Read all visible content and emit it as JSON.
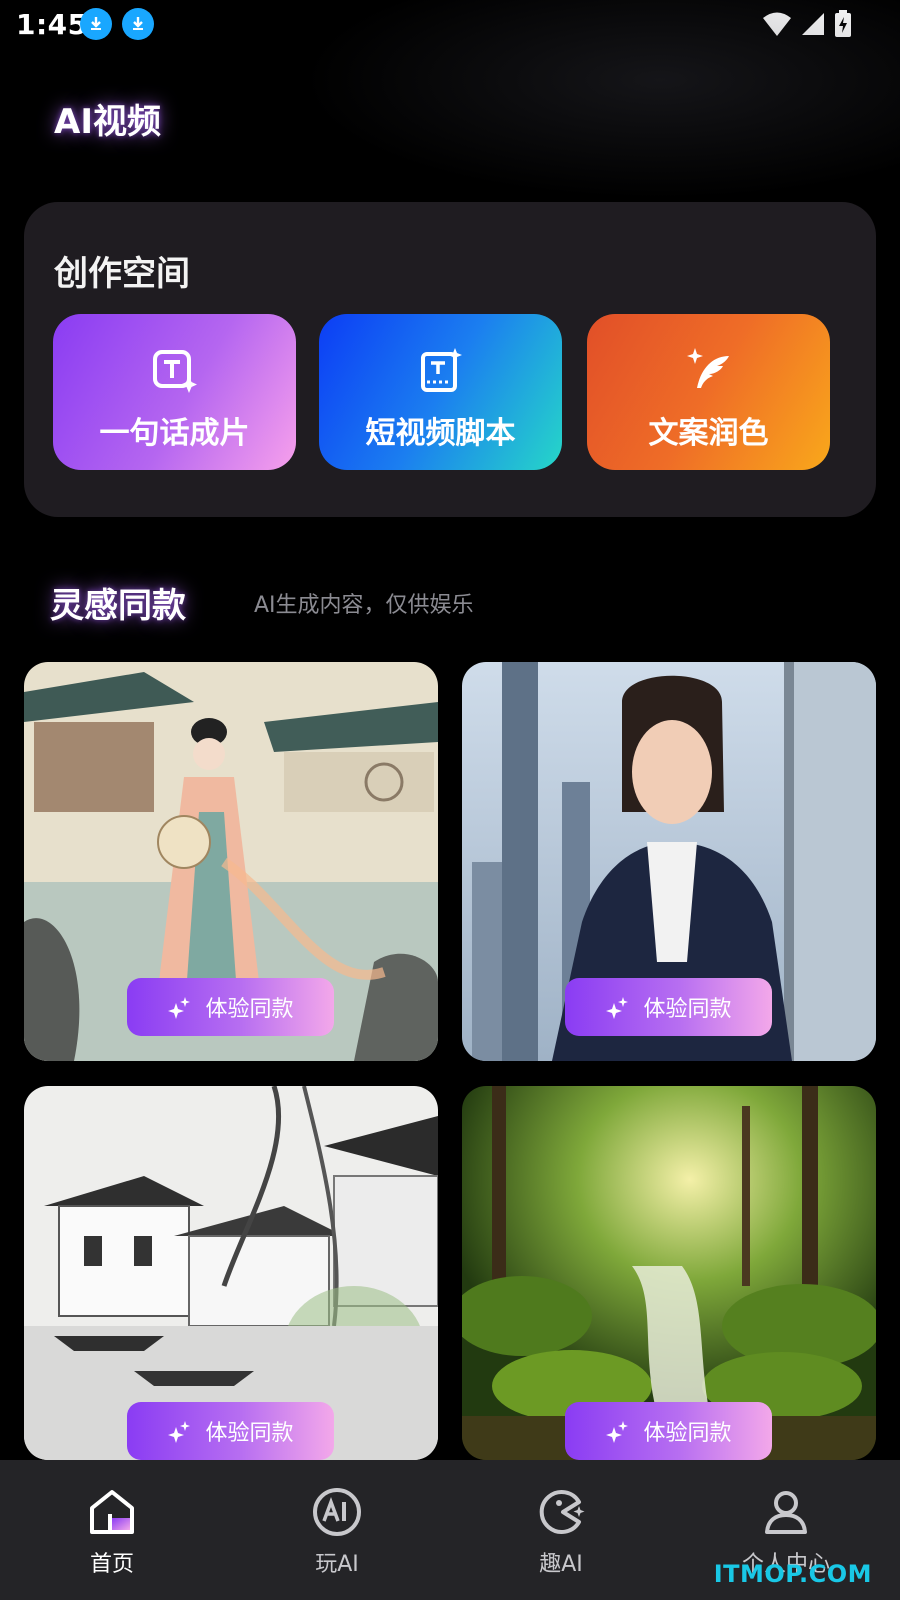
{
  "status_bar": {
    "time": "1:45"
  },
  "header": {
    "title": "AI视频"
  },
  "create_space": {
    "title": "创作空间",
    "cards": [
      {
        "label": "一句话成片",
        "icon": "text-sparkle-icon"
      },
      {
        "label": "短视频脚本",
        "icon": "film-script-icon"
      },
      {
        "label": "文案润色",
        "icon": "quill-sparkle-icon"
      }
    ]
  },
  "inspiration": {
    "title": "灵感同款",
    "note": "AI生成内容，仅供娱乐",
    "tiles": [
      {
        "button_label": "体验同款"
      },
      {
        "button_label": "体验同款"
      },
      {
        "button_label": "体验同款"
      },
      {
        "button_label": "体验同款"
      }
    ]
  },
  "bottom_nav": {
    "items": [
      {
        "label": "首页",
        "active": true
      },
      {
        "label": "玩AI",
        "active": false
      },
      {
        "label": "趣AI",
        "active": false
      },
      {
        "label": "个人中心",
        "active": false
      }
    ]
  },
  "watermark": "ITMOP.COM",
  "colors": {
    "accent_purple": "#8a3cf3",
    "accent_pink": "#f3a8ea",
    "panel_bg": "#1f1c21",
    "nav_bg": "#242427"
  }
}
